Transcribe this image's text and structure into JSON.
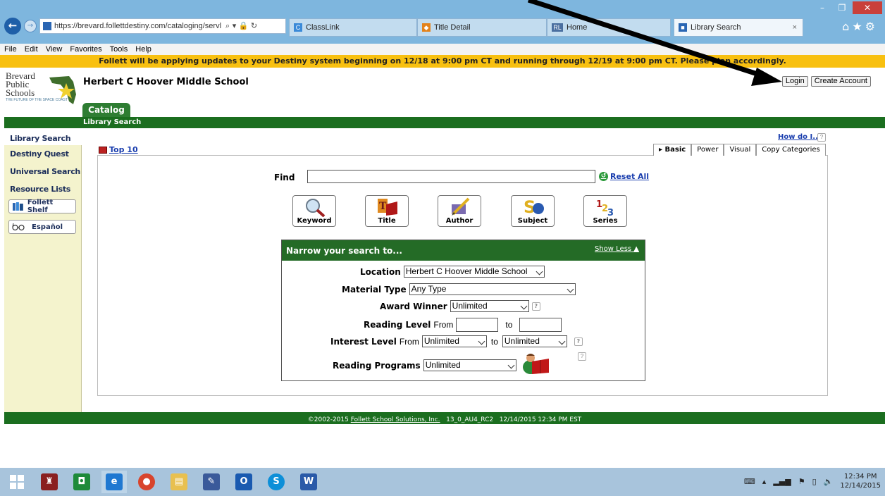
{
  "browser": {
    "url": "https://brevard.follettdestiny.com/cataloging/servl",
    "url_domain": "follettdestiny.com",
    "tabs": [
      "ClassLink",
      "Title Detail",
      "Home",
      "Library Search"
    ],
    "tab_badge_home": "RL",
    "window_controls": [
      "–",
      "❐",
      "✕"
    ],
    "menu": [
      "File",
      "Edit",
      "View",
      "Favorites",
      "Tools",
      "Help"
    ]
  },
  "notice": "Follett will be applying updates to your Destiny system beginning on 12/18 at 9:00 pm CT and running through 12/19 at 9:00 pm CT. Please plan accordingly.",
  "header": {
    "logo_lines": [
      "Brevard",
      "Public",
      "Schools"
    ],
    "logo_sub": "THE FUTURE OF THE SPACE COAST",
    "school": "Herbert C Hoover Middle School",
    "login": "Login",
    "create_account": "Create Account",
    "catalog_tab": "Catalog",
    "sub_label": "Library Search"
  },
  "sidebar": {
    "items": [
      "Library Search",
      "Destiny Quest",
      "Universal Search",
      "Resource Lists"
    ],
    "buttons": [
      "Follett Shelf",
      "Español"
    ]
  },
  "content": {
    "how_do_i": "How do I...",
    "top10": "Top 10",
    "tabs": [
      "Basic",
      "Power",
      "Visual",
      "Copy Categories"
    ],
    "find_label": "Find",
    "find_value": "",
    "reset_all": "Reset All",
    "search_buttons": [
      "Keyword",
      "Title",
      "Author",
      "Subject",
      "Series"
    ]
  },
  "narrow": {
    "title": "Narrow your search to...",
    "show_less": "Show Less",
    "location_label": "Location",
    "location_value": "Herbert C Hoover Middle School",
    "material_label": "Material Type",
    "material_value": "Any Type",
    "award_label": "Award Winner",
    "award_value": "Unlimited",
    "reading_label": "Reading Level",
    "from": "From",
    "to": "to",
    "interest_label": "Interest Level",
    "interest_from": "Unlimited",
    "interest_to": "Unlimited",
    "programs_label": "Reading Programs",
    "programs_value": "Unlimited"
  },
  "footer": {
    "copyright": "©2002-2015",
    "company": "Follett School Solutions, Inc.",
    "version": "13_0_AU4_RC2",
    "timestamp": "12/14/2015 12:34 PM EST"
  },
  "taskbar": {
    "time": "12:34 PM",
    "date": "12/14/2015"
  }
}
